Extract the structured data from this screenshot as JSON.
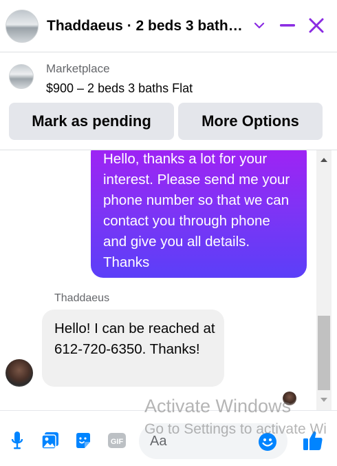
{
  "header": {
    "title": "Thaddaeus · 2 beds 3 bath…",
    "chevron_icon": "chevron-down-icon",
    "minimize_icon": "minimize-icon",
    "close_icon": "close-icon",
    "accent": "#8a2be2"
  },
  "listing": {
    "source": "Marketplace",
    "title": "$900 – 2 beds 3 baths Flat",
    "actions": {
      "mark_pending": "Mark as pending",
      "more_options": "More Options"
    }
  },
  "thread": {
    "outgoing_message": "Hello, thanks a lot for your interest. Please send me your phone number so that we can contact you through phone and give you all details. Thanks",
    "incoming_sender": "Thaddaeus",
    "incoming_message": "Hello! I can be reached at 612-720-6350. Thanks!"
  },
  "watermark": {
    "line1": "Activate Windows",
    "line2": "Go to Settings to activate Wi"
  },
  "composer": {
    "placeholder": "Aa",
    "icons": [
      "microphone-icon",
      "photo-icon",
      "sticker-icon",
      "gif-icon",
      "emoji-icon",
      "thumbs-up-icon"
    ],
    "accent": "#0084ff"
  }
}
